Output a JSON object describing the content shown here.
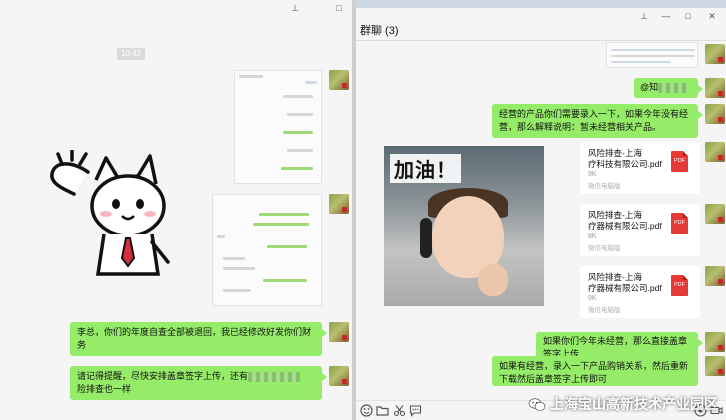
{
  "left_window": {
    "controls": {
      "pin": "⊥",
      "maximize": "□"
    },
    "timestamp": "10:42",
    "messages": [
      {
        "text": "李总，你们的年度自查全部被退回，我已经修改好发你们财务"
      },
      {
        "text_before": "请记得提醒，尽快安排盖章签字上传，还有",
        "text_after": "险排查也一样"
      }
    ]
  },
  "right_window": {
    "controls": {
      "pin": "⊥",
      "minimize": "—",
      "maximize": "□",
      "close": "✕"
    },
    "title": "群聊 (3)",
    "mention_bubble": {
      "prefix": "@知"
    },
    "explain_bubble": "经营的产品你们需要录入一下，如果今年没有经营，那么解释说明：暂未经营相关产品。",
    "gif_caption": "加油！",
    "files": [
      {
        "name_line1": "风险排查-上海",
        "name_line2": "疗科技有限公司.pdf",
        "size": "9K",
        "source": "微信电脑版",
        "icon": "PDF"
      },
      {
        "name_line1": "风险排查-上海",
        "name_line2": "疗器械有限公司.pdf",
        "size": "8K",
        "source": "微信电脑版",
        "icon": "PDF"
      },
      {
        "name_line1": "风险排查-上海",
        "name_line2": "疗器械有限公司.pdf",
        "size": "9K",
        "source": "微信电脑版",
        "icon": "PDF"
      }
    ],
    "bubble_no_business": "如果你们今年未经营，那么直接盖章签字上传",
    "bubble_business": "如果有经营，录入一下产品购销关系，然后重新下载然后盖章签字上传即可",
    "watermark": "上海宝山高新技术产业园区"
  }
}
